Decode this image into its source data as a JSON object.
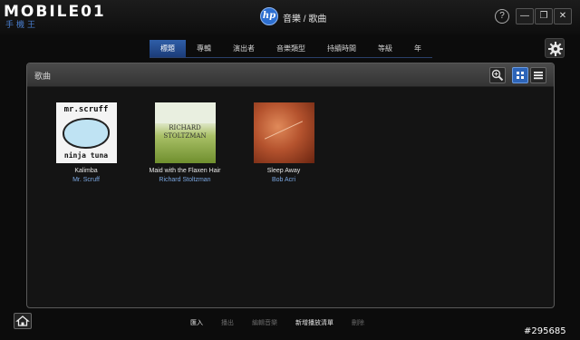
{
  "branding": {
    "logo_text": "MOBILE01",
    "logo_sub": "手機王"
  },
  "window": {
    "title": "音樂 / 歌曲",
    "hp_logo": "hp",
    "help": "?",
    "minimize": "—",
    "restore": "❐",
    "close": "✕"
  },
  "tabs": [
    {
      "label": "標題",
      "active": true
    },
    {
      "label": "專輯",
      "active": false
    },
    {
      "label": "演出者",
      "active": false
    },
    {
      "label": "音樂類型",
      "active": false
    },
    {
      "label": "持續時間",
      "active": false
    },
    {
      "label": "等級",
      "active": false
    },
    {
      "label": "年",
      "active": false
    }
  ],
  "panel": {
    "title": "歌曲",
    "zoom_icon": "zoom-in-icon",
    "grid_icon": "grid-view-icon",
    "list_icon": "list-view-icon"
  },
  "albums": [
    {
      "title": "Kalimba",
      "artist": "Mr. Scruff",
      "cover_top": "mr.scruff",
      "cover_bottom": "ninja tuna"
    },
    {
      "title": "Maid with the Flaxen Hair",
      "artist": "Richard Stoltzman",
      "cover_top": "RICHARD",
      "cover_bottom": "STOLTZMAN"
    },
    {
      "title": "Sleep Away",
      "artist": "Bob Acri"
    }
  ],
  "bottom_bar": [
    {
      "label": "匯入",
      "enabled": true
    },
    {
      "label": "播出",
      "enabled": false
    },
    {
      "label": "編輯音樂",
      "enabled": false
    },
    {
      "label": "新增播放清單",
      "enabled": true
    },
    {
      "label": "刪除",
      "enabled": false
    }
  ],
  "watermark": "#295685",
  "colors": {
    "accent": "#2d64b8",
    "artist_link": "#7aa6e0",
    "background": "#0c0c0c"
  }
}
